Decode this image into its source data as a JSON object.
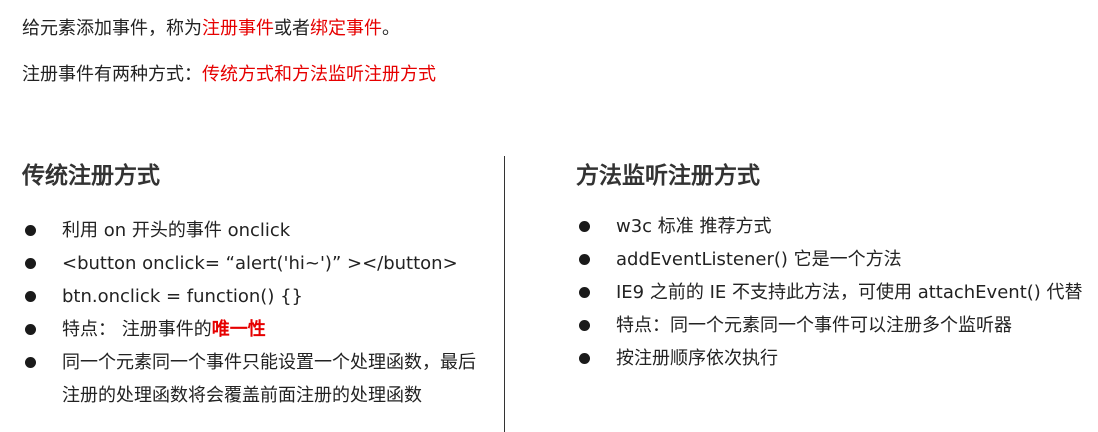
{
  "intro": {
    "line1_prefix": "给元素添加事件，称为",
    "line1_term1": "注册事件",
    "line1_mid": "或者",
    "line1_term2": "绑定事件",
    "line1_end": "。",
    "line2_prefix": "注册事件有两种方式：",
    "line2_highlight": "传统方式和方法监听注册方式"
  },
  "left": {
    "heading": "传统注册方式",
    "items": [
      "利用 on 开头的事件 onclick",
      "<button onclick= “alert('hi~')” ></button>",
      "btn.onclick = function() {}",
      "特点： 注册事件的",
      "同一个元素同一个事件只能设置一个处理函数，最后注册的处理函数将会覆盖前面注册的处理函数"
    ],
    "item4_highlight": "唯一性"
  },
  "right": {
    "heading": "方法监听注册方式",
    "items": [
      "w3c 标准 推荐方式",
      "addEventListener() 它是一个方法",
      "IE9 之前的 IE 不支持此方法，可使用 attachEvent() 代替",
      "特点：同一个元素同一个事件可以注册多个监听器",
      "按注册顺序依次执行"
    ]
  },
  "colors": {
    "highlight": "#e60000",
    "text": "#222222",
    "heading": "#333333"
  }
}
